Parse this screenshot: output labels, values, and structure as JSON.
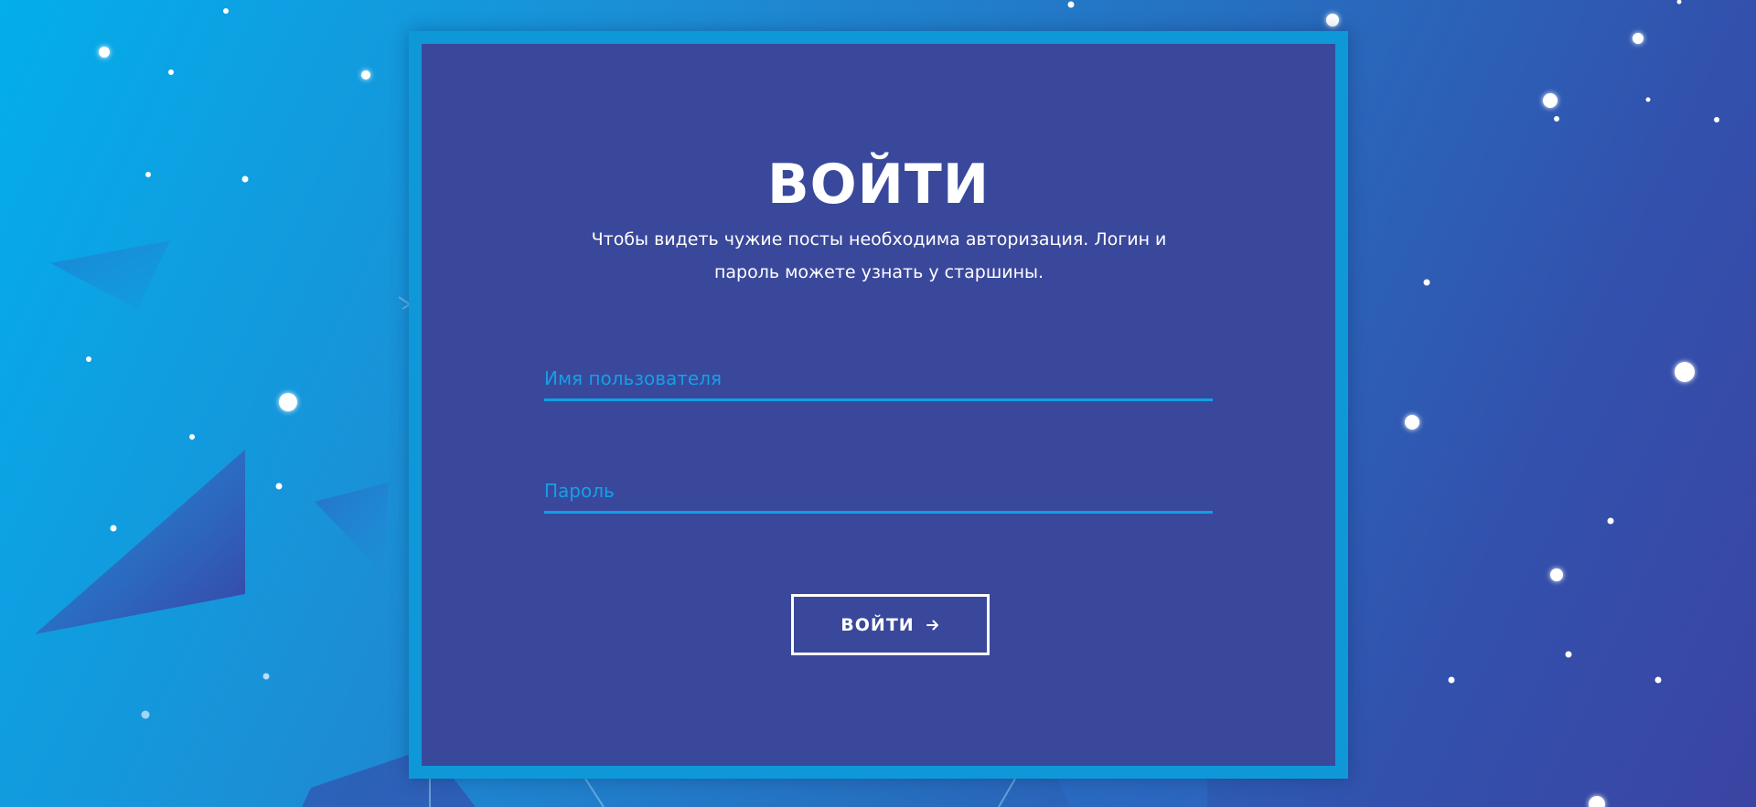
{
  "login": {
    "title": "ВОЙТИ",
    "subtitle": "Чтобы видеть чужие посты необходима авторизация. Логин и пароль можете узнать у старшины.",
    "username_placeholder": "Имя пользователя",
    "username_value": "",
    "password_placeholder": "Пароль",
    "password_value": "",
    "submit_label": "ВОЙТИ",
    "submit_icon": "arrow-right-icon"
  },
  "colors": {
    "background_start": "#03aeeb",
    "background_end": "#3b44a2",
    "card_frame": "#0f98d8",
    "card_fill": "#3a489b",
    "input_underline": "#0ea1e6",
    "placeholder": "#13a0e6",
    "text": "#ffffff"
  }
}
